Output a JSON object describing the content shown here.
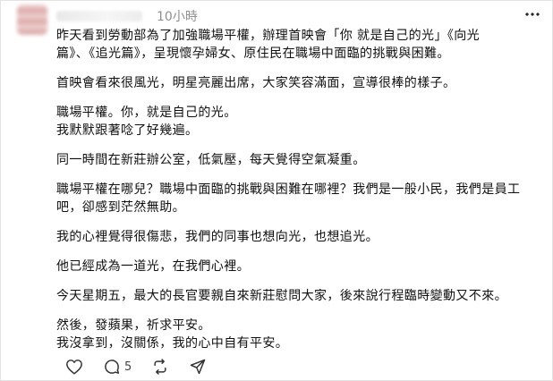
{
  "post": {
    "timestamp": "10小時",
    "paragraphs": [
      [
        "昨天看到勞動部為了加強職場平權，辦理首映會「你 就是自己的光」《向光",
        "篇》、《追光篇》，呈現懷孕婦女、原住民在職場中面臨的挑戰與困難。"
      ],
      [
        "首映會看來很風光，明星亮麗出席，大家笑容滿面，宣導很棒的樣子。"
      ],
      [
        "職場平權。你，就是自己的光。",
        "我默默跟著唸了好幾遍。"
      ],
      [
        "同一時間在新莊辦公室，低氣壓，每天覺得空氣凝重。"
      ],
      [
        "職場平權在哪兒？職場中面臨的挑戰與困難在哪裡？我們是一般小民，我們是員工",
        "吧，卻感到茫然無助。"
      ],
      [
        "我的心裡覺得很傷悲，我們的同事也想向光，也想追光。"
      ],
      [
        "他已經成為一道光，在我們心裡。"
      ],
      [
        "今天星期五，最大的長官要親自來新莊慰問大家，後來說行程臨時變動又不來。"
      ],
      [
        "然後，發蘋果，祈求平安。",
        "我沒拿到，沒關係，我的心中自有平安。"
      ]
    ]
  },
  "actions": {
    "like_icon": "heart-icon",
    "comment_icon": "comment-icon",
    "comment_count": "5",
    "repost_icon": "repost-icon",
    "share_icon": "share-icon"
  },
  "more_icon": "more-options-icon"
}
